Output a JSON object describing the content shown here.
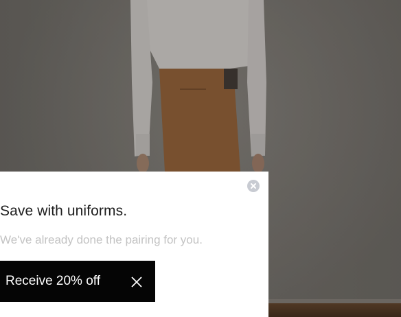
{
  "promo": {
    "headline": "Save with uniforms.",
    "subline": "We've already done the pairing for you.",
    "cta_label": "Receive 20% off"
  },
  "icons": {
    "dismiss": "close-circle-icon",
    "cta_dismiss": "close-x-icon"
  },
  "colors": {
    "card_background": "#ffffff",
    "cta_background": "#050505",
    "headline_text": "#1d1d1d",
    "subline_text": "#c3c3c3",
    "close_circle": "#c8cbd2"
  }
}
